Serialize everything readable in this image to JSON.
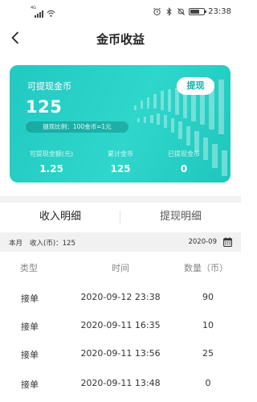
{
  "status_bar": {
    "network_tag": "4G",
    "time": "23:38",
    "battery_level": 0.6
  },
  "nav": {
    "back_icon": "chevron-left-icon",
    "title": "金币收益"
  },
  "card": {
    "withdrawable_label": "可提现金币",
    "withdrawable_amount": "125",
    "ratio_text": "提现比例：100金币=1元",
    "withdraw_button": "提现",
    "stats": [
      {
        "label": "可提现金额(元)",
        "value": "1.25"
      },
      {
        "label": "累计金币",
        "value": "125"
      },
      {
        "label": "已提现金币",
        "value": "0"
      }
    ],
    "gradient_colors": [
      "#22c9c1",
      "#1fc6bd"
    ]
  },
  "tabs": [
    {
      "label": "收入明细",
      "active": true
    },
    {
      "label": "提现明细",
      "active": false
    }
  ],
  "filter": {
    "month_label": "本月",
    "income_text": "收入(币)：125",
    "date": "2020-09",
    "calendar_icon": "calendar-icon"
  },
  "table": {
    "headers": {
      "type": "类型",
      "time": "时间",
      "qty": "数量（币）"
    },
    "rows": [
      {
        "type": "接单",
        "time": "2020-09-12 23:38",
        "qty": "90"
      },
      {
        "type": "接单",
        "time": "2020-09-11 16:35",
        "qty": "10"
      },
      {
        "type": "接单",
        "time": "2020-09-11 13:56",
        "qty": "25"
      },
      {
        "type": "接单",
        "time": "2020-09-11 13:48",
        "qty": "0"
      }
    ]
  }
}
